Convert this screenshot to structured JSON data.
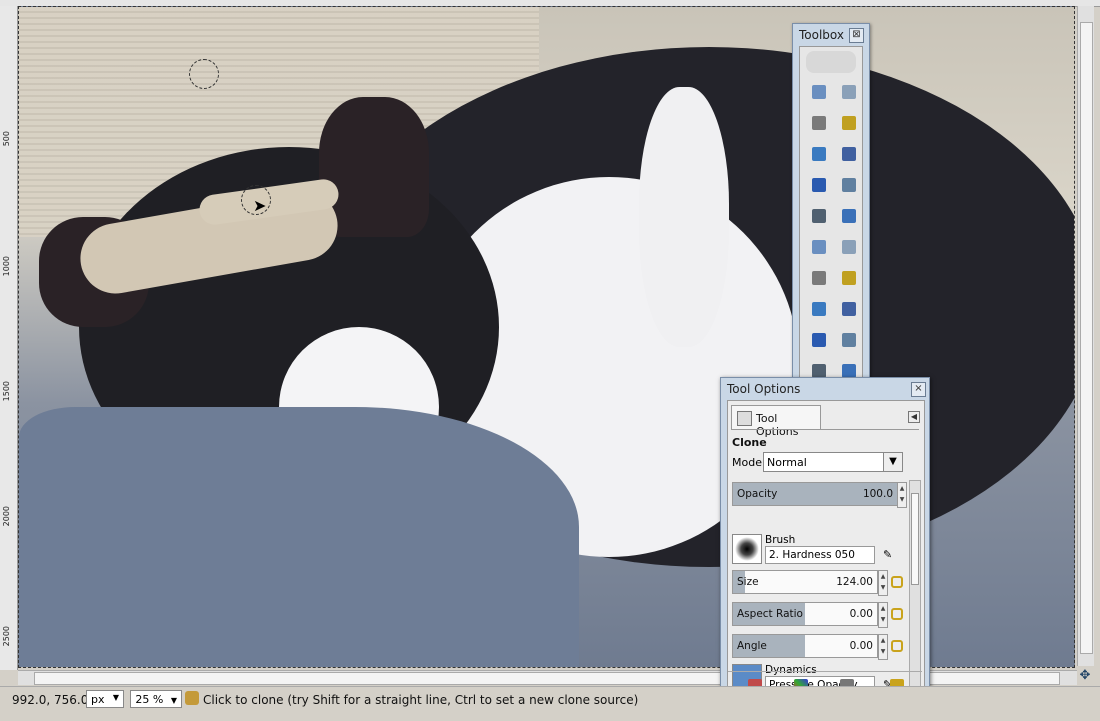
{
  "ruler": {
    "left_ticks": [
      "500",
      "1000",
      "1500",
      "2000",
      "2500"
    ]
  },
  "toolbox": {
    "title": "Toolbox",
    "close_glyph": "⊠",
    "tools": [
      "rect-select-icon",
      "ellipse-select-icon",
      "free-select-icon",
      "fuzzy-select-icon",
      "color-select-icon",
      "scissors-select-icon",
      "foreground-select-icon",
      "paths-icon",
      "color-picker-icon",
      "zoom-icon",
      "measure-icon",
      "move-icon",
      "align-icon",
      "crop-icon",
      "rotate-icon",
      "scale-icon",
      "shear-icon",
      "perspective-icon",
      "flip-icon",
      "cage-transform-icon"
    ]
  },
  "tool_options": {
    "title": "Tool Options",
    "close_glyph": "×",
    "tab_label": "Tool Options",
    "tool_name": "Clone",
    "mode_label": "Mode:",
    "mode_value": "Normal",
    "opacity": {
      "label": "Opacity",
      "value": "100.0",
      "fraction": 1.0
    },
    "brush": {
      "label": "Brush",
      "value": "2. Hardness 050"
    },
    "size": {
      "label": "Size",
      "value": "124.00",
      "fraction": 0.08
    },
    "aspect_ratio": {
      "label": "Aspect Ratio",
      "value": "0.00",
      "fraction": 0.5
    },
    "angle": {
      "label": "Angle",
      "value": "0.00",
      "fraction": 0.5
    },
    "dynamics": {
      "label": "Dynamics",
      "value": "Pressure Opacity"
    },
    "footer_buttons": [
      "save-options-icon",
      "restore-options-icon",
      "delete-options-icon",
      "reset-options-icon"
    ]
  },
  "statusbar": {
    "coords": "992.0, 756.0",
    "unit": "px",
    "zoom": "25 %",
    "message": "Click to clone (try Shift for a straight line, Ctrl to set a new clone source)"
  },
  "colors": {
    "panel_bg": "#c9d7e6",
    "accent_chain": "#c9a31c"
  }
}
